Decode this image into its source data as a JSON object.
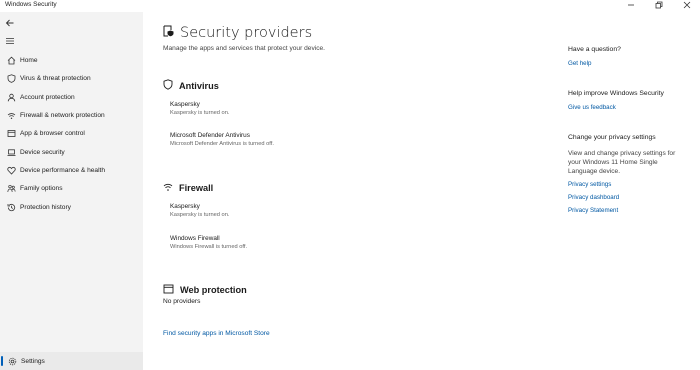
{
  "window": {
    "title": "Windows Security"
  },
  "sidebar": {
    "items": [
      {
        "label": "Home"
      },
      {
        "label": "Virus & threat protection"
      },
      {
        "label": "Account protection"
      },
      {
        "label": "Firewall & network protection"
      },
      {
        "label": "App & browser control"
      },
      {
        "label": "Device security"
      },
      {
        "label": "Device performance & health"
      },
      {
        "label": "Family options"
      },
      {
        "label": "Protection history"
      }
    ],
    "settings_label": "Settings"
  },
  "main": {
    "title": "Security providers",
    "subtitle": "Manage the apps and services that protect your device.",
    "sections": [
      {
        "title": "Antivirus",
        "providers": [
          {
            "name": "Kaspersky",
            "status": "Kaspersky is turned on."
          },
          {
            "name": "Microsoft Defender Antivirus",
            "status": "Microsoft Defender Antivirus is turned off."
          }
        ]
      },
      {
        "title": "Firewall",
        "providers": [
          {
            "name": "Kaspersky",
            "status": "Kaspersky is turned on."
          },
          {
            "name": "Windows Firewall",
            "status": "Windows Firewall is turned off."
          }
        ]
      },
      {
        "title": "Web protection",
        "empty_text": "No providers"
      }
    ],
    "store_link": "Find security apps in Microsoft Store"
  },
  "right": {
    "question_heading": "Have a question?",
    "get_help": "Get help",
    "improve_heading": "Help improve Windows Security",
    "feedback": "Give us feedback",
    "privacy_heading": "Change your privacy settings",
    "privacy_text": "View and change privacy settings for your Windows 11 Home Single Language device.",
    "privacy_links": [
      "Privacy settings",
      "Privacy dashboard",
      "Privacy Statement"
    ]
  },
  "colors": {
    "accent": "#005fb8",
    "link": "#0058a3",
    "sidebar_bg": "#f3f3f3"
  }
}
